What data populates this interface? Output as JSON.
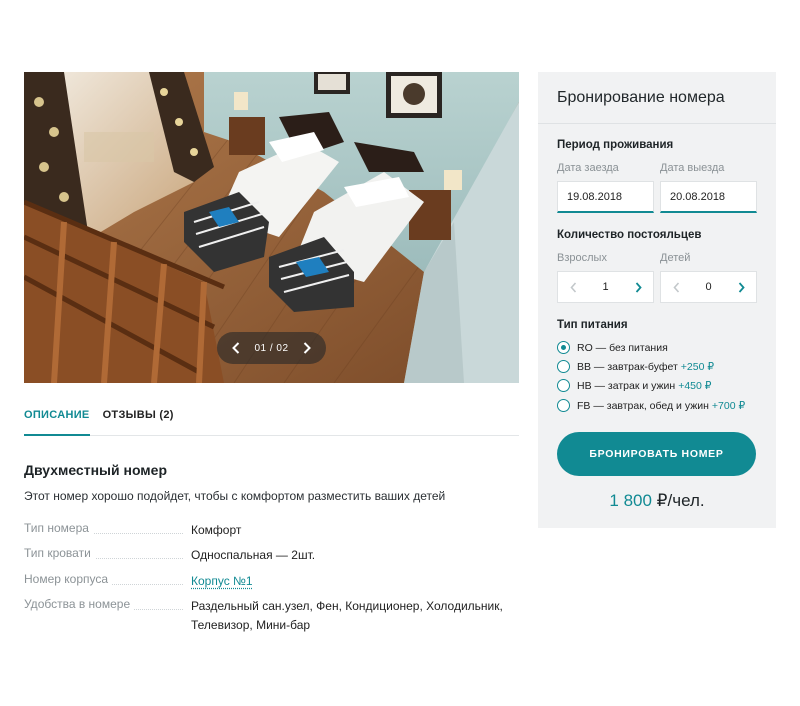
{
  "gallery": {
    "counter": "01 / 02",
    "prev_icon": "chevron-left-icon",
    "next_icon": "chevron-right-icon"
  },
  "tabs": [
    {
      "label": "ОПИСАНИЕ",
      "active": true
    },
    {
      "label": "ОТЗЫВЫ (2)",
      "active": false
    }
  ],
  "room": {
    "title": "Двухместный номер",
    "subtitle": "Этот номер хорошо подойдет, чтобы с комфортом разместить ваших детей",
    "specs": [
      {
        "key": "Тип номера",
        "value": "Комфорт"
      },
      {
        "key": "Тип кровати",
        "value": "Односпальная — 2шт."
      },
      {
        "key": "Номер корпуса",
        "value": "Корпус №1"
      },
      {
        "key": "Удобства в номере",
        "value": "Раздельный сан.узел, Фен, Кондиционер, Холодильник, Телевизор, Мини-бар"
      }
    ]
  },
  "booking": {
    "title": "Бронирование номера",
    "period_title": "Период проживания",
    "checkin_label": "Дата заезда",
    "checkin_value": "19.08.2018",
    "checkout_label": "Дата выезда",
    "checkout_value": "20.08.2018",
    "guests_title": "Количество постояльцев",
    "adults_label": "Взрослых",
    "adults_value": "1",
    "children_label": "Детей",
    "children_value": "0",
    "meal_title": "Тип питания",
    "meals": [
      {
        "label": "RO — без питания",
        "price": "",
        "checked": true
      },
      {
        "label": "BB — завтрак-буфет",
        "price": "+250 ₽",
        "checked": false
      },
      {
        "label": "HB — затрак и ужин",
        "price": "+450 ₽",
        "checked": false
      },
      {
        "label": "FB — завтрак, обед и ужин",
        "price": "+700 ₽",
        "checked": false
      }
    ],
    "button_label": "БРОНИРОВАТЬ НОМЕР",
    "price_amount": "1 800",
    "price_unit": "₽/чел."
  },
  "colors": {
    "accent": "#118a93",
    "panel_bg": "#f1f2f3",
    "muted_text": "#8c9397"
  }
}
